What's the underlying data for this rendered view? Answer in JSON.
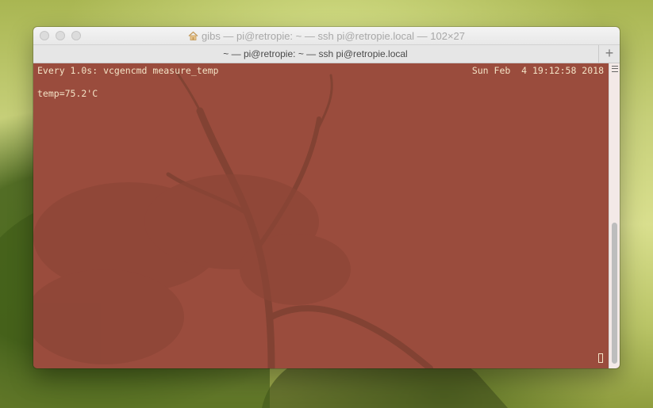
{
  "window": {
    "title": "gibs — pi@retropie: ~ — ssh pi@retropie.local — 102×27",
    "tab_title": "~ — pi@retropie: ~ — ssh pi@retropie.local",
    "new_tab_label": "+"
  },
  "terminal": {
    "header_command": "Every 1.0s: vcgencmd measure_temp",
    "header_datetime": "Sun Feb  4 19:12:58 2018",
    "output": "temp=75.2'C"
  },
  "colors": {
    "terminal_background": "#9a4c3d",
    "terminal_text": "#f3e3c6"
  },
  "icons": {
    "title_icon": "home-icon"
  }
}
